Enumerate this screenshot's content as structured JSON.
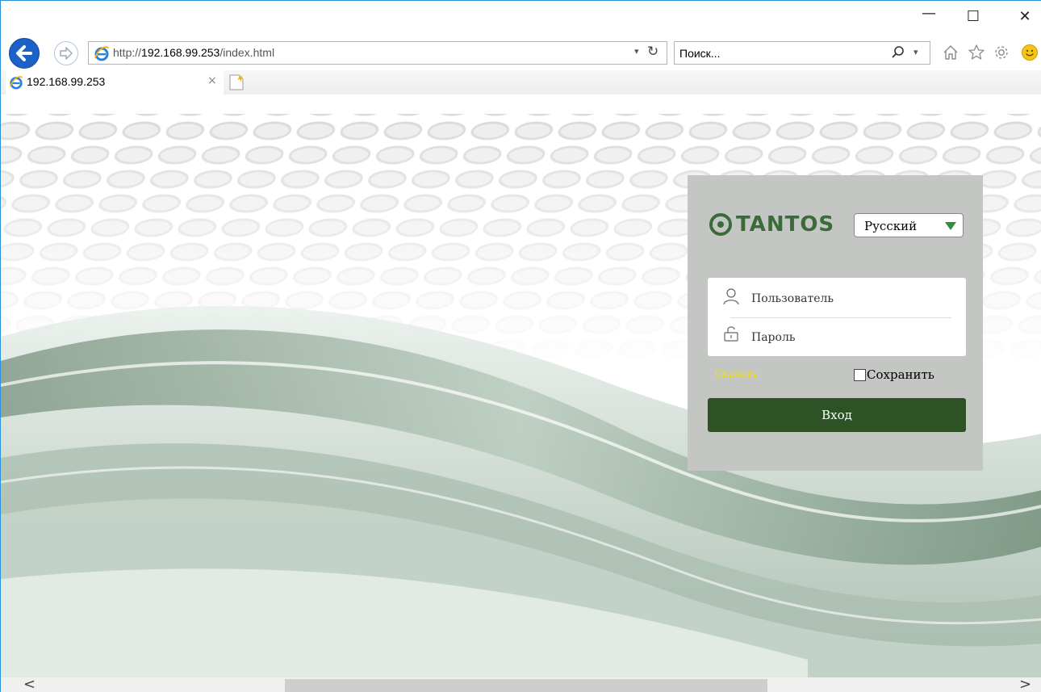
{
  "window": {
    "minimize_glyph": "—",
    "maximize_glyph": "☐",
    "close_glyph": "✕"
  },
  "nav": {
    "back_icon": "back-arrow-icon",
    "forward_icon": "forward-arrow-icon",
    "url_prefix": "http://",
    "url_host": "192.168.99.253",
    "url_path": "/index.html",
    "dropdown_glyph": "▾",
    "refresh_glyph": "↻",
    "search_placeholder": "Поиск...",
    "search_dropdown_glyph": "▾"
  },
  "tab": {
    "title": "192.168.99.253",
    "close_glyph": "×"
  },
  "login": {
    "brand": "TANTOS",
    "language": "Русский",
    "username_placeholder": "Пользователь",
    "password_placeholder": "Пароль",
    "download_link": "Скачать",
    "remember_label": "Сохранить",
    "submit_label": "Вход"
  },
  "scrollbar": {
    "left_glyph": "<",
    "right_glyph": ">"
  },
  "colors": {
    "ie_blue": "#1d61c6",
    "brand_green": "#3c6b3a",
    "button_green": "#2d5226",
    "link_yellow": "#f5e000"
  }
}
